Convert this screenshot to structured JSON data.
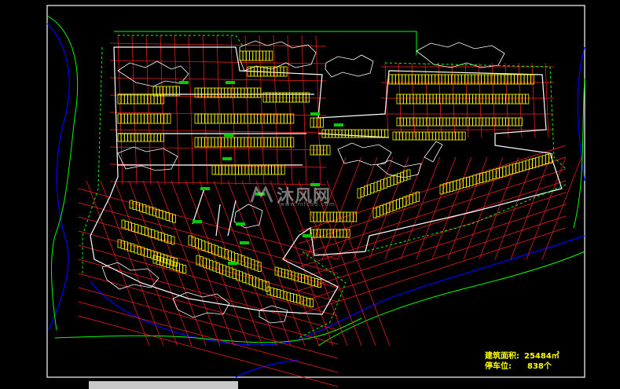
{
  "drawing": {
    "colors": {
      "background": "#000000",
      "frame": "#ffffff",
      "site_boundary": "#00ff00",
      "river": "#0000ff",
      "grid": "#ff2020",
      "parking": "#ffff00",
      "buildings": "#ffffff",
      "markers": "#00ff00"
    }
  },
  "legend": {
    "area_label": "建筑面积:",
    "area_value": "25484㎡",
    "spaces_label": "停车位:",
    "spaces_value": "838个"
  },
  "watermark": {
    "brand": "沐风网",
    "url": "www.mfcad.com"
  }
}
